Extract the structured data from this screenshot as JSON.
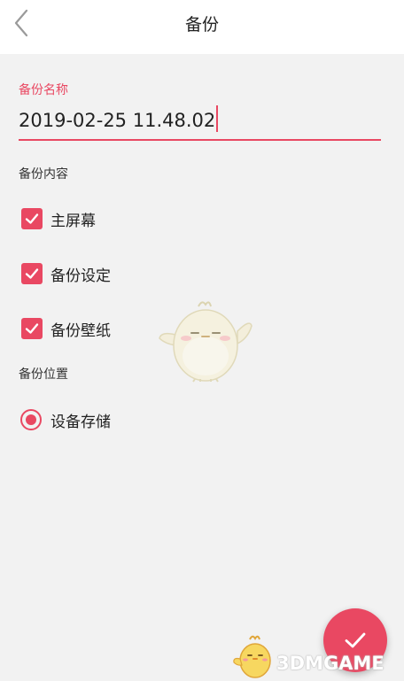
{
  "header": {
    "title": "备份"
  },
  "backup_name": {
    "label": "备份名称",
    "value": "2019-02-25 11.48.02"
  },
  "content": {
    "label": "备份内容",
    "items": [
      {
        "label": "主屏幕",
        "checked": true
      },
      {
        "label": "备份设定",
        "checked": true
      },
      {
        "label": "备份壁纸",
        "checked": true
      }
    ]
  },
  "location": {
    "label": "备份位置",
    "options": [
      {
        "label": "设备存储",
        "selected": true
      }
    ]
  },
  "watermark": {
    "text": "3DMGAME"
  },
  "colors": {
    "accent": "#e94862",
    "background": "#f2f2f2",
    "header": "#ffffff"
  }
}
